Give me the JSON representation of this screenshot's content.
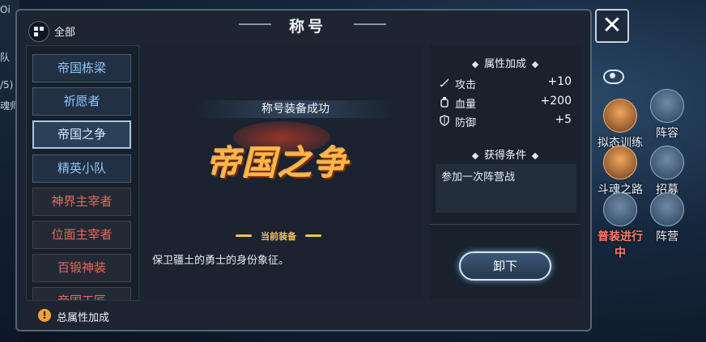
{
  "background": {
    "left_fragments": [
      "Oi",
      "队",
      "/5)",
      "魂师"
    ],
    "side_buttons": [
      {
        "label": "拟态训练",
        "icon": "training-icon"
      },
      {
        "label": "阵容",
        "icon": "lineup-icon"
      },
      {
        "label": "斗魂之路",
        "icon": "soul-road-icon"
      },
      {
        "label": "招募",
        "icon": "recruit-icon"
      },
      {
        "label": "普装进行中",
        "icon": "equipment-icon"
      },
      {
        "label": "阵营",
        "icon": "faction-icon"
      }
    ]
  },
  "header": {
    "title": "称号",
    "filter_label": "全部",
    "close_symbol": "✕"
  },
  "titles_list": [
    {
      "label": "帝国栋梁",
      "style": "blue"
    },
    {
      "label": "祈愿者",
      "style": "blue"
    },
    {
      "label": "帝国之争",
      "style": "selected"
    },
    {
      "label": "精英小队",
      "style": "blue"
    },
    {
      "label": "神界主宰者",
      "style": "red"
    },
    {
      "label": "位面主宰者",
      "style": "red"
    },
    {
      "label": "百锻神装",
      "style": "red"
    },
    {
      "label": "帝国工匠",
      "style": "red"
    }
  ],
  "detail": {
    "equip_success": "称号装备成功",
    "emblem_text": "帝国之争",
    "current_label": "当前装备",
    "description": "保卫疆土的勇士的身份象征。"
  },
  "attributes": {
    "section_title": "属性加成",
    "stats": [
      {
        "name": "攻击",
        "value": "+10",
        "icon": "sword-icon"
      },
      {
        "name": "血量",
        "value": "+200",
        "icon": "potion-icon"
      },
      {
        "name": "防御",
        "value": "+5",
        "icon": "shield-icon"
      }
    ]
  },
  "conditions": {
    "section_title": "获得条件",
    "text": "参加一次阵营战"
  },
  "actions": {
    "unequip_label": "卸下"
  },
  "footer": {
    "total_label": "总属性加成",
    "info_symbol": "!"
  }
}
